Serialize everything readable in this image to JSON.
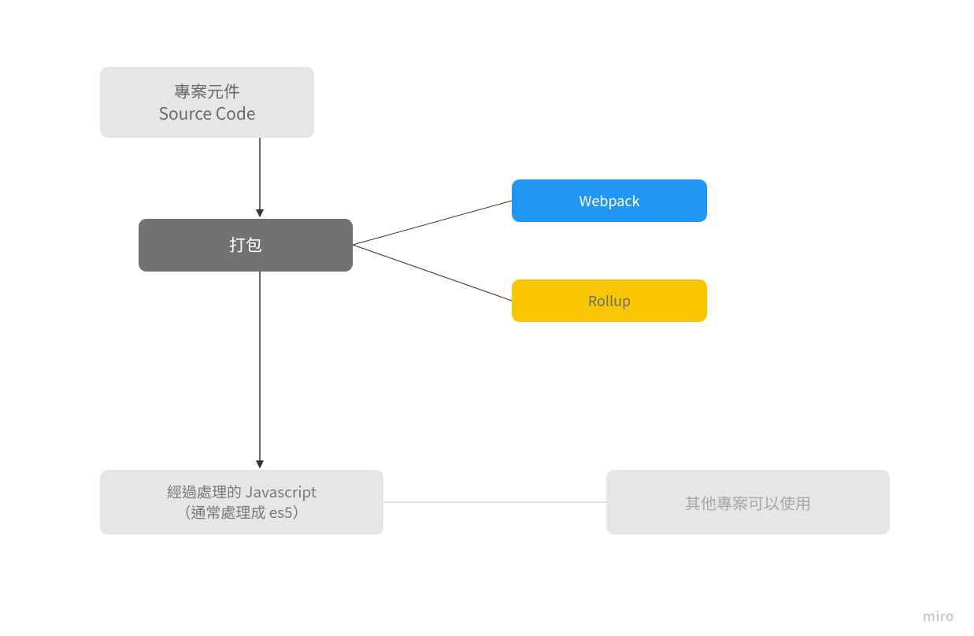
{
  "nodes": {
    "source": {
      "line1": "專案元件",
      "line2": "Source Code"
    },
    "bundle": {
      "label": "打包"
    },
    "webpack": {
      "label": "Webpack"
    },
    "rollup": {
      "label": "Rollup"
    },
    "output": {
      "line1": "經過處理的 Javascript",
      "line2": "（通常處理成 es5）"
    },
    "usable": {
      "label": "其他專案可以使用"
    }
  },
  "watermark": "miro",
  "colors": {
    "light_gray": "#e6e6e6",
    "dark_gray": "#727272",
    "blue": "#2196f3",
    "yellow": "#f7c600",
    "line": "#333333",
    "faint_line": "#d7d7d7"
  }
}
